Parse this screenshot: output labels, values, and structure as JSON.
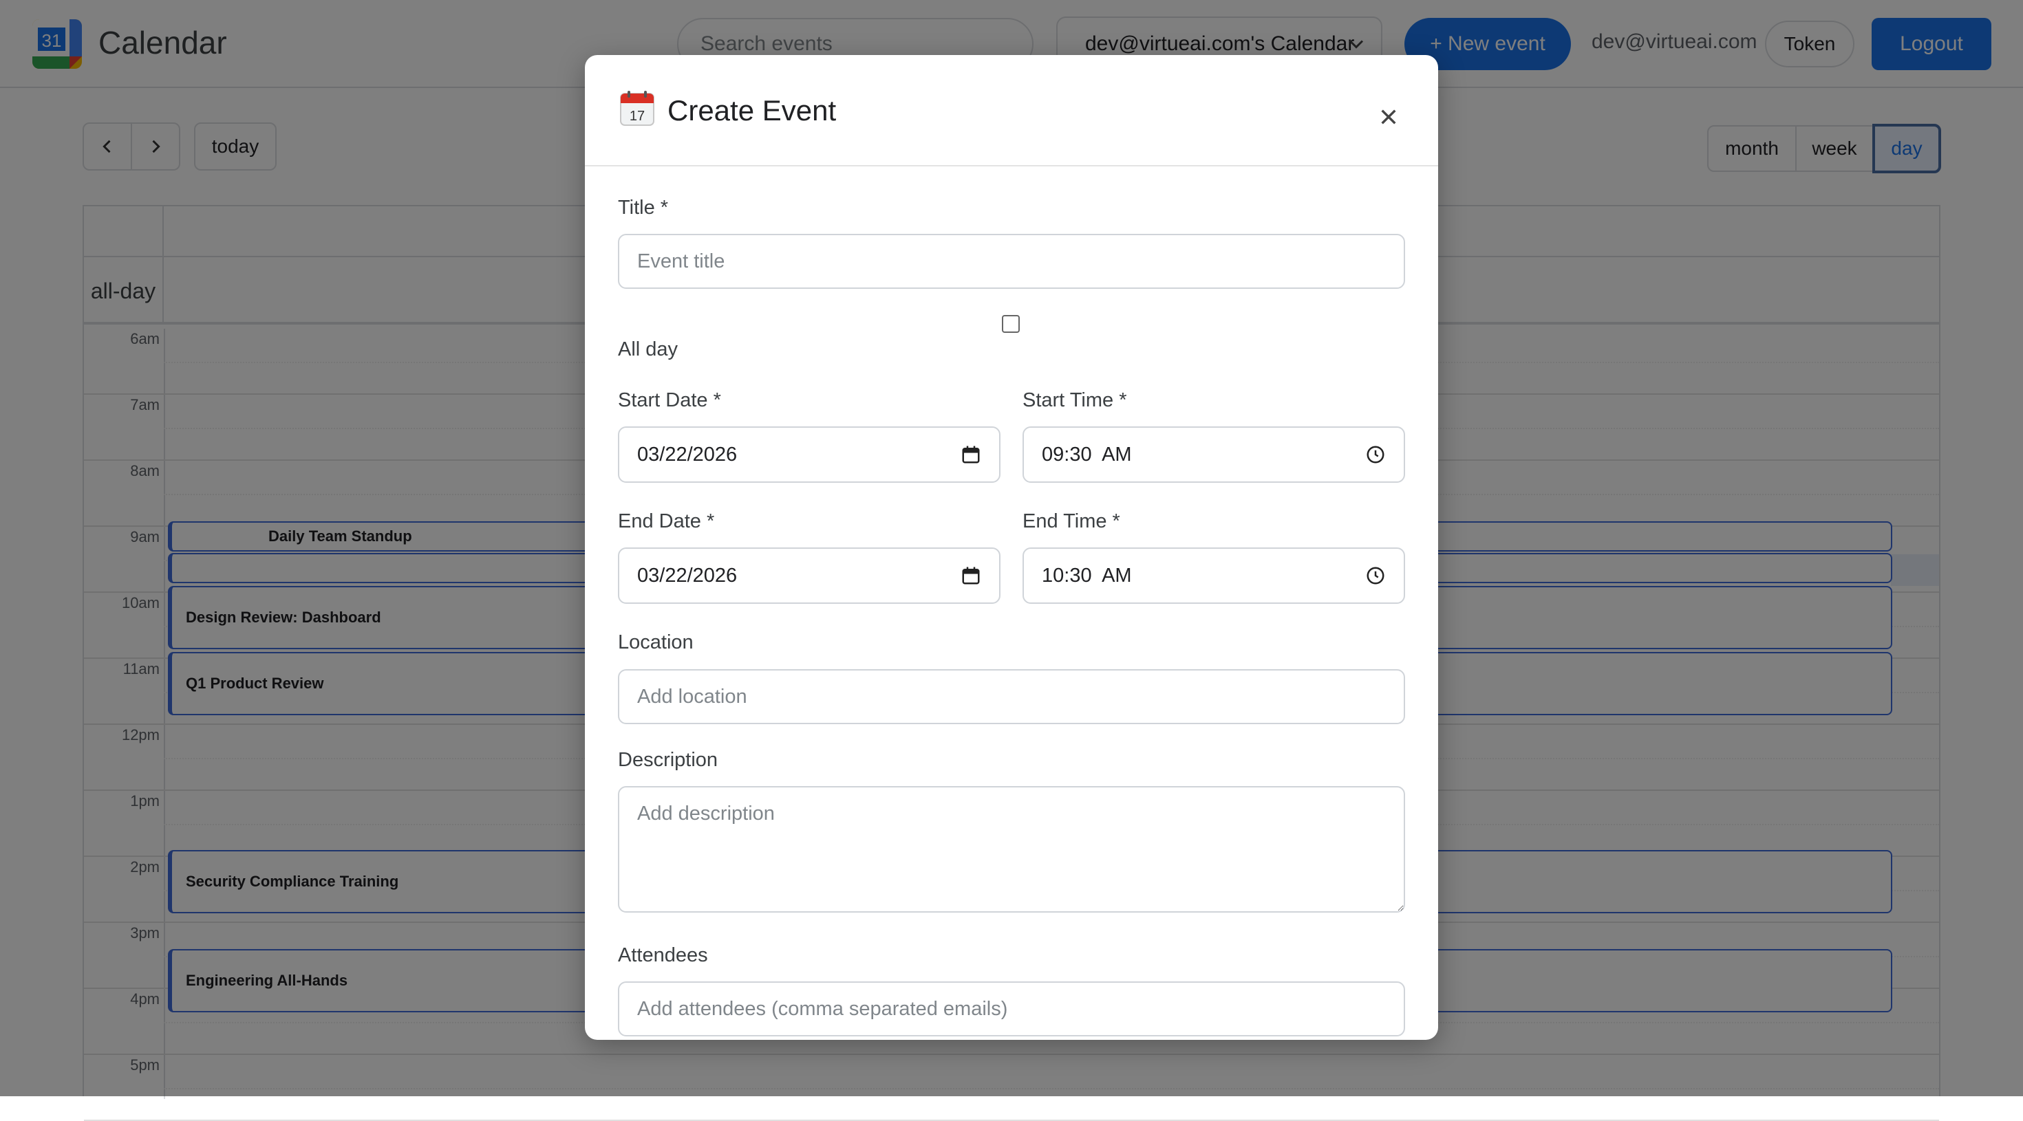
{
  "header": {
    "app_title": "Calendar",
    "logo_number": "31",
    "search_placeholder": "Search events",
    "calendar_selected": "dev@virtueai.com's Calendar",
    "new_event_label": "+ New event",
    "user_email": "dev@virtueai.com",
    "token_label": "Token",
    "logout_label": "Logout"
  },
  "toolbar": {
    "prev_icon": "chevron-left-icon",
    "next_icon": "chevron-right-icon",
    "today_label": "today",
    "views": [
      "month",
      "week",
      "day"
    ],
    "active_view": "day"
  },
  "grid": {
    "allday_label": "all-day",
    "hours": [
      "6am",
      "7am",
      "8am",
      "9am",
      "10am",
      "11am",
      "12pm",
      "1pm",
      "2pm",
      "3pm",
      "4pm",
      "5pm"
    ],
    "events": [
      {
        "title": "Daily Team Standup"
      },
      {
        "title": "Design Review: Dashboard"
      },
      {
        "title": "Q1 Product Review"
      },
      {
        "title": "Security Compliance Training"
      },
      {
        "title": "Engineering All-Hands"
      }
    ]
  },
  "modal": {
    "icon_day": "17",
    "title": "Create Event",
    "close_icon": "close-icon",
    "title_label": "Title *",
    "title_placeholder": "Event title",
    "allday_label": "All day",
    "allday_checked": false,
    "start_date_label": "Start Date *",
    "start_date_value": "03/22/2026",
    "start_time_label": "Start Time *",
    "start_time_value": "09:30  AM",
    "end_date_label": "End Date *",
    "end_date_value": "03/22/2026",
    "end_time_label": "End Time *",
    "end_time_value": "10:30  AM",
    "location_label": "Location",
    "location_placeholder": "Add location",
    "description_label": "Description",
    "description_placeholder": "Add description",
    "attendees_label": "Attendees",
    "attendees_placeholder": "Add attendees (comma separated emails)"
  },
  "colors": {
    "primary": "#1a73e8",
    "event_border": "#3f6ad8",
    "overlay": "rgba(0,0,0,0.5)"
  }
}
